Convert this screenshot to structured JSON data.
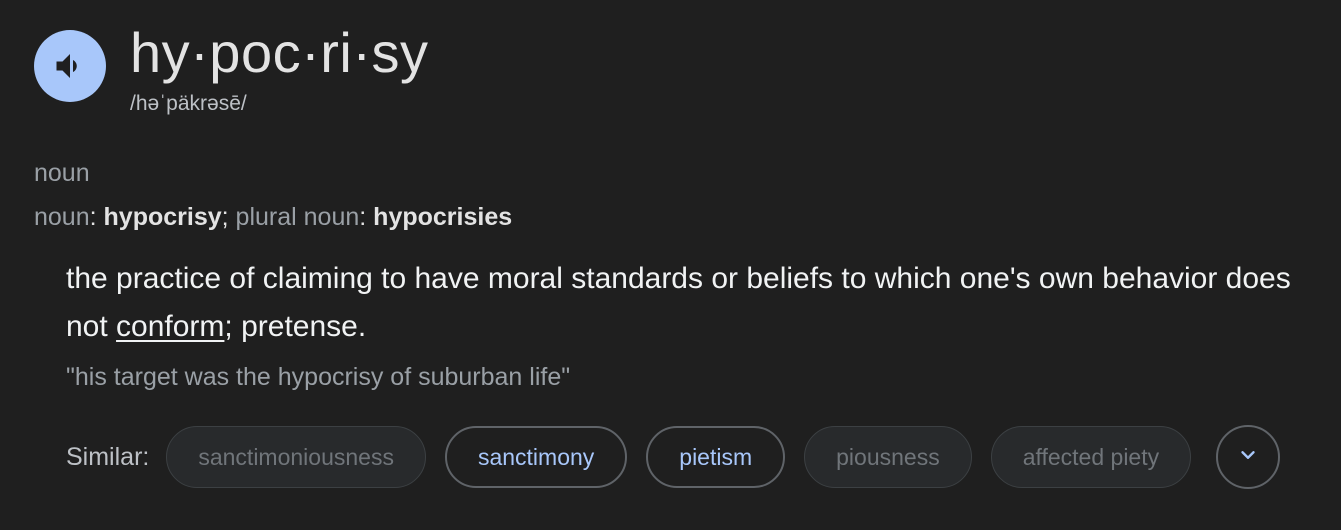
{
  "entry": {
    "headword": "hy·poc·ri·sy",
    "phonetic": "/həˈpäkrəsē/",
    "part_of_speech": "noun"
  },
  "inflections": {
    "noun_label": "noun",
    "noun_form": "hypocrisy",
    "plural_label": "plural noun",
    "plural_form": "hypocrisies",
    "colon": ":",
    "semicolon": ";"
  },
  "definition": {
    "text_before": "the practice of claiming to have moral standards or beliefs to which one's own behavior does not ",
    "link_word": "conform",
    "text_after": "; pretense.",
    "example": "\"his target was the hypocrisy of suburban life\""
  },
  "similar": {
    "label": "Similar:",
    "chips": [
      {
        "label": "sanctimoniousness",
        "state": "disabled"
      },
      {
        "label": "sanctimony",
        "state": "active"
      },
      {
        "label": "pietism",
        "state": "active"
      },
      {
        "label": "piousness",
        "state": "disabled"
      },
      {
        "label": "affected piety",
        "state": "disabled"
      }
    ],
    "expand_icon": "chevron-down-icon"
  },
  "colors": {
    "background": "#1f1f1f",
    "speaker_button": "#a8c7fa",
    "active_chip_text": "#a8c7fa",
    "disabled_chip_bg": "#282a2c"
  },
  "icons": {
    "speaker": "speaker-icon"
  }
}
